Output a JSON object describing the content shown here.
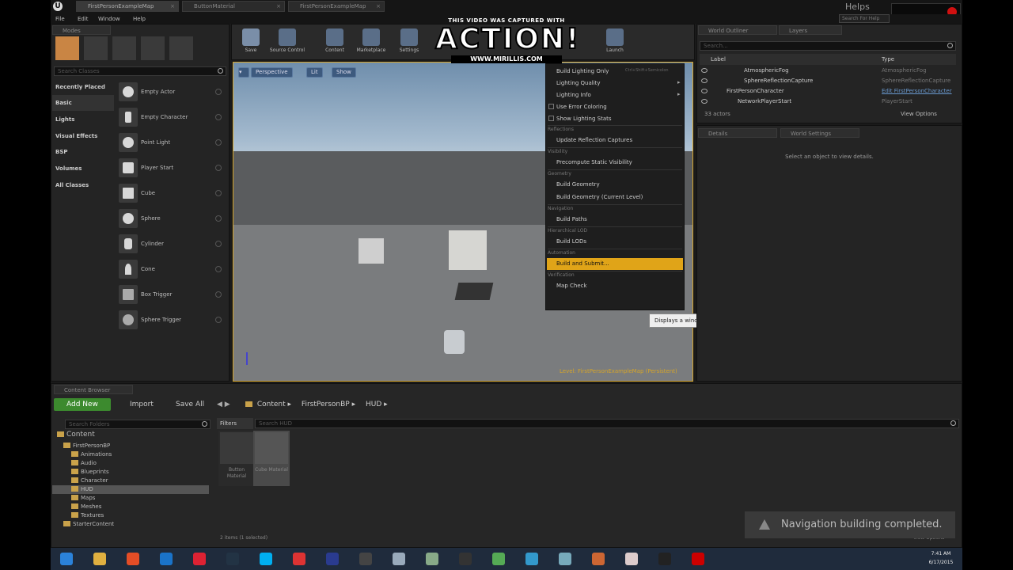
{
  "window": {
    "tabs": [
      "FirstPersonExampleMap",
      "ButtonMaterial",
      "FirstPersonExampleMap"
    ],
    "helps": "Helps",
    "search_help_placeholder": "Search For Help"
  },
  "menubar": {
    "items": [
      "File",
      "Edit",
      "Window",
      "Help"
    ]
  },
  "modes": {
    "tab": "Modes",
    "search_placeholder": "Search Classes",
    "categories": [
      "Recently Placed",
      "Basic",
      "Lights",
      "Visual Effects",
      "BSP",
      "Volumes",
      "All Classes"
    ],
    "selected_category": "Basic",
    "items": [
      "Empty Actor",
      "Empty Character",
      "Point Light",
      "Player Start",
      "Cube",
      "Sphere",
      "Cylinder",
      "Cone",
      "Box Trigger",
      "Sphere Trigger"
    ]
  },
  "toolbar": {
    "buttons": [
      "Save",
      "Source Control",
      "Content",
      "Marketplace",
      "Settings",
      "Launch"
    ]
  },
  "watermark": {
    "top": "THIS VIDEO WAS CAPTURED WITH",
    "big": "ACTION!",
    "url": "WWW.MIRILLIS.COM"
  },
  "viewport": {
    "buttons": [
      "Perspective",
      "Lit",
      "Show"
    ],
    "level_label": "Level: FirstPersonExampleMap (Persistent)"
  },
  "build_menu": {
    "items": [
      {
        "type": "item",
        "label": "Build Lighting Only",
        "shortcut": "Ctrl+Shift+Semicolon"
      },
      {
        "type": "item",
        "label": "Lighting Quality",
        "arrow": true
      },
      {
        "type": "item",
        "label": "Lighting Info",
        "arrow": true
      },
      {
        "type": "check",
        "label": "Use Error Coloring"
      },
      {
        "type": "check",
        "label": "Show Lighting Stats"
      },
      {
        "type": "section",
        "label": "Reflections"
      },
      {
        "type": "item",
        "label": "Update Reflection Captures"
      },
      {
        "type": "section",
        "label": "Visibility"
      },
      {
        "type": "item",
        "label": "Precompute Static Visibility"
      },
      {
        "type": "section",
        "label": "Geometry"
      },
      {
        "type": "item",
        "label": "Build Geometry"
      },
      {
        "type": "item",
        "label": "Build Geometry (Current Level)"
      },
      {
        "type": "section",
        "label": "Navigation"
      },
      {
        "type": "item",
        "label": "Build Paths"
      },
      {
        "type": "section",
        "label": "Hierarchical LOD"
      },
      {
        "type": "item",
        "label": "Build LODs"
      },
      {
        "type": "section",
        "label": "Automation"
      },
      {
        "type": "highlight",
        "label": "Build and Submit..."
      },
      {
        "type": "section",
        "label": "Verification"
      },
      {
        "type": "item",
        "label": "Map Check"
      }
    ],
    "tooltip": "Displays a window that allows you to build all levels and submit them to source control"
  },
  "outliner": {
    "tabs": [
      "World Outliner",
      "Layers"
    ],
    "search_placeholder": "Search...",
    "col_label": "Label",
    "col_type": "Type",
    "rows": [
      {
        "label": "AtmosphericFog",
        "type": "AtmosphericFog"
      },
      {
        "label": "SphereReflectionCapture",
        "type": "SphereReflectionCapture"
      },
      {
        "label": "FirstPersonCharacter",
        "type": "Edit FirstPersonCharacter"
      },
      {
        "label": "NetworkPlayerStart",
        "type": "PlayerStart"
      }
    ],
    "count": "33 actors",
    "view_options": "View Options"
  },
  "details": {
    "tabs": [
      "Details",
      "World Settings"
    ],
    "empty": "Select an object to view details."
  },
  "content_browser": {
    "tab": "Content Browser",
    "add_new": "Add New",
    "import": "Import",
    "save_all": "Save All",
    "path": [
      "Content",
      "FirstPersonBP",
      "HUD"
    ],
    "filters": "Filters",
    "search_assets_placeholder": "Search HUD",
    "search_folders_placeholder": "Search Folders",
    "tree": [
      {
        "label": "Content",
        "depth": 0
      },
      {
        "label": "FirstPersonBP",
        "depth": 1
      },
      {
        "label": "Animations",
        "depth": 2
      },
      {
        "label": "Audio",
        "depth": 2
      },
      {
        "label": "Blueprints",
        "depth": 2
      },
      {
        "label": "Character",
        "depth": 2
      },
      {
        "label": "HUD",
        "depth": 2,
        "selected": true
      },
      {
        "label": "Maps",
        "depth": 2
      },
      {
        "label": "Meshes",
        "depth": 2
      },
      {
        "label": "Textures",
        "depth": 2
      },
      {
        "label": "StarterContent",
        "depth": 1
      }
    ],
    "assets": [
      {
        "name": "Button Material"
      },
      {
        "name": "Cube Material"
      }
    ],
    "status": "2 items (1 selected)",
    "view_options": "View Options"
  },
  "toast": "Navigation building completed.",
  "taskbar": {
    "time": "7:41 AM",
    "date": "6/17/2015",
    "apps": [
      "windows-start-icon",
      "file-explorer-icon",
      "chrome-icon",
      "edge-icon",
      "app-icon",
      "steam-icon",
      "skype-icon",
      "app-icon",
      "photoshop-icon",
      "unreal-icon",
      "app-icon",
      "app-icon",
      "app-icon",
      "app-icon",
      "app-icon",
      "app-icon",
      "app-icon",
      "app-icon",
      "app-icon",
      "record-icon"
    ],
    "app_colors": [
      "#2b82d9",
      "#e0b040",
      "#e44d26",
      "#1a73c8",
      "#d23",
      "#223344",
      "#00aff0",
      "#d33",
      "#2a3b8f",
      "#444",
      "#9ab",
      "#8a8",
      "#333",
      "#5a5",
      "#39c",
      "#7ab",
      "#c63",
      "#dcc",
      "#222",
      "#c00"
    ]
  }
}
